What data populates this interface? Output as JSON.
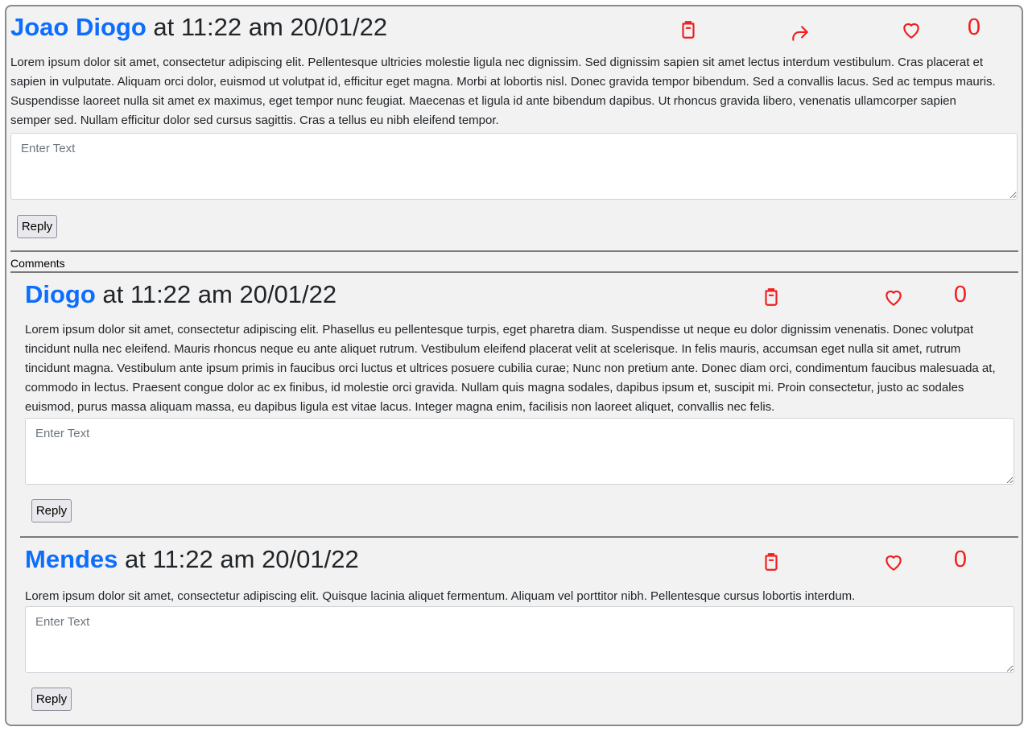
{
  "post": {
    "author": "Joao Diogo",
    "timestamp": " at 11:22 am 20/01/22",
    "body": "Lorem ipsum dolor sit amet, consectetur adipiscing elit. Pellentesque ultricies molestie ligula nec dignissim. Sed dignissim sapien sit amet lectus interdum vestibulum. Cras placerat et sapien in vulputate. Aliquam orci dolor, euismod ut volutpat id, efficitur eget magna. Morbi at lobortis nisl. Donec gravida tempor bibendum. Sed a convallis lacus. Sed ac tempus mauris. Suspendisse laoreet nulla sit amet ex maximus, eget tempor nunc feugiat. Maecenas et ligula id ante bibendum dapibus. Ut rhoncus gravida libero, venenatis ullamcorper sapien semper sed. Nullam efficitur dolor sed cursus sagittis. Cras a tellus eu nibh eleifend tempor.",
    "like_count": "0",
    "reply_placeholder": "Enter Text",
    "reply_label": "Reply",
    "delete_icon": "trash-icon",
    "share_icon": "share-icon",
    "like_icon": "heart-icon"
  },
  "comments_label": "Comments",
  "comments": [
    {
      "author": "Diogo",
      "timestamp": " at 11:22 am 20/01/22",
      "body": "Lorem ipsum dolor sit amet, consectetur adipiscing elit. Phasellus eu pellentesque turpis, eget pharetra diam. Suspendisse ut neque eu dolor dignissim venenatis. Donec volutpat tincidunt nulla nec eleifend. Mauris rhoncus neque eu ante aliquet rutrum. Vestibulum eleifend placerat velit at scelerisque. In felis mauris, accumsan eget nulla sit amet, rutrum tincidunt magna. Vestibulum ante ipsum primis in faucibus orci luctus et ultrices posuere cubilia curae; Nunc non pretium ante. Donec diam orci, condimentum faucibus malesuada at, commodo in lectus. Praesent congue dolor ac ex finibus, id molestie orci gravida. Nullam quis magna sodales, dapibus ipsum et, suscipit mi. Proin consectetur, justo ac sodales euismod, purus massa aliquam massa, eu dapibus ligula est vitae lacus. Integer magna enim, facilisis non laoreet aliquet, convallis nec felis.",
      "like_count": "0",
      "reply_placeholder": "Enter Text",
      "reply_label": "Reply"
    },
    {
      "author": "Mendes",
      "timestamp": " at 11:22 am 20/01/22",
      "body": "Lorem ipsum dolor sit amet, consectetur adipiscing elit. Quisque lacinia aliquet fermentum. Aliquam vel porttitor nibh. Pellentesque cursus lobortis interdum.",
      "like_count": "0",
      "reply_placeholder": "Enter Text",
      "reply_label": "Reply"
    }
  ],
  "colors": {
    "author": "#0d6efd",
    "icon_accent": "#f01e1e",
    "card_background": "#f2f2f2"
  }
}
